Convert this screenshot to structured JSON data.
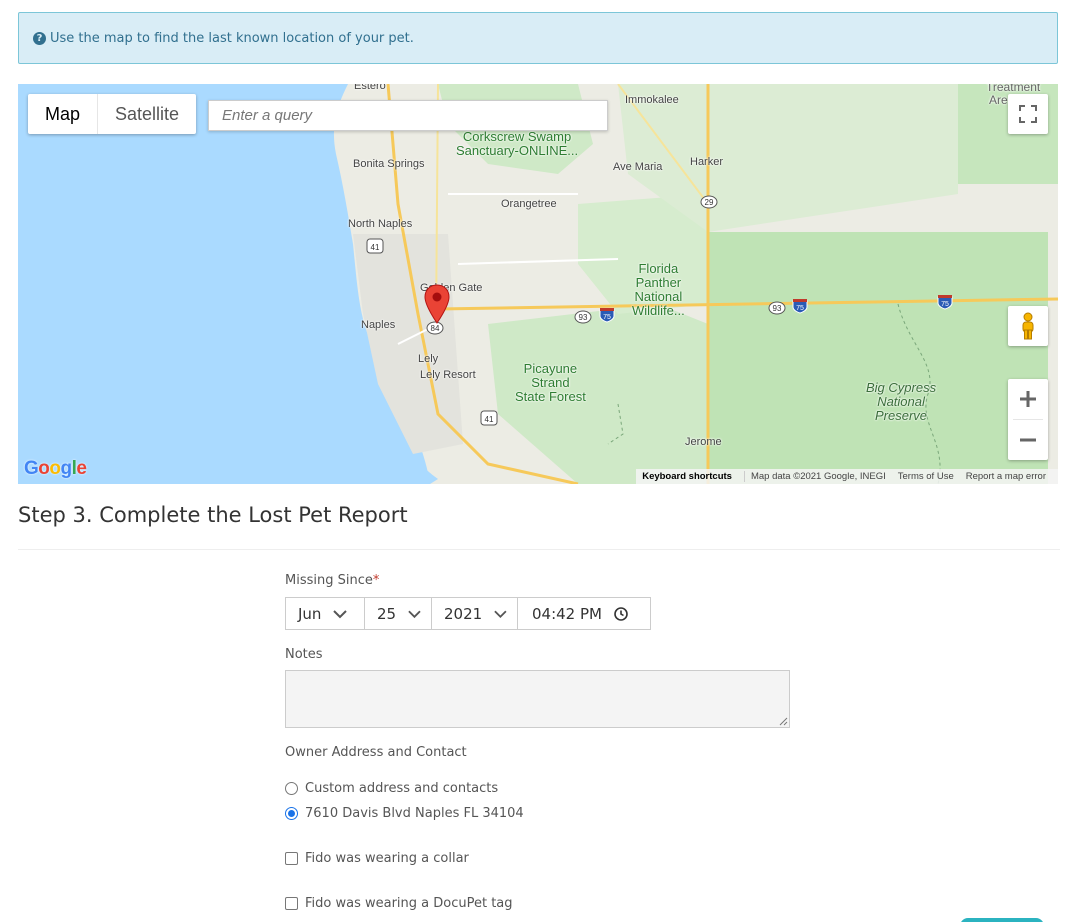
{
  "banner": {
    "icon": "question-circle-icon",
    "text": "Use the map to find the last known location of your pet."
  },
  "map": {
    "type_buttons": [
      "Map",
      "Satellite"
    ],
    "query_placeholder": "Enter a query",
    "labels": {
      "estero": "Estero",
      "immokalee": "Immokalee",
      "treatment": "Treatment",
      "are": "Are",
      "corkscrew": "Corkscrew Swamp\nSanctuary-ONLINE...",
      "bonita": "Bonita Springs",
      "ave_maria": "Ave Maria",
      "harker": "Harker",
      "orangetree": "Orangetree",
      "north_naples": "North Naples",
      "florida_panther": "Florida\nPanther\nNational\nWildlife...",
      "golden_gate": "Golden Gate",
      "naples": "Naples",
      "lely": "Lely",
      "lely_resort": "Lely Resort",
      "picayune": "Picayune\nStrand\nState Forest",
      "big_cypress": "Big Cypress\nNational\nPreserve",
      "jerome": "Jerome"
    },
    "shields": {
      "us41a": "41",
      "us41b": "41",
      "sr29": "29",
      "sr84": "84",
      "sr93a": "93",
      "sr93b": "93",
      "i75a": "75",
      "i75b": "75",
      "i75c": "75"
    },
    "google_logo": "Google",
    "attribution": {
      "keyboard": "Keyboard shortcuts",
      "data": "Map data ©2021 Google, INEGI",
      "terms": "Terms of Use",
      "report": "Report a map error"
    },
    "colors": {
      "water": "#aadaff",
      "land": "#ecece4",
      "park": "#c8e6c0",
      "highway": "#f6c95a",
      "marker": "#ea4335"
    }
  },
  "step": {
    "title": "Step 3. Complete the Lost Pet Report"
  },
  "form": {
    "missing_since": {
      "label": "Missing Since",
      "required_mark": "*",
      "month": "Jun",
      "day": "25",
      "year": "2021",
      "time": "04:42 PM"
    },
    "notes": {
      "label": "Notes",
      "value": ""
    },
    "owner": {
      "label": "Owner Address and Contact",
      "options": [
        {
          "label": "Custom address and contacts",
          "selected": false
        },
        {
          "label": "7610 Davis Blvd Naples FL 34104",
          "selected": true
        }
      ]
    },
    "checkboxes": [
      {
        "label": "Fido was wearing a collar",
        "checked": false
      },
      {
        "label": "Fido was wearing a DocuPet tag",
        "checked": false
      }
    ]
  }
}
